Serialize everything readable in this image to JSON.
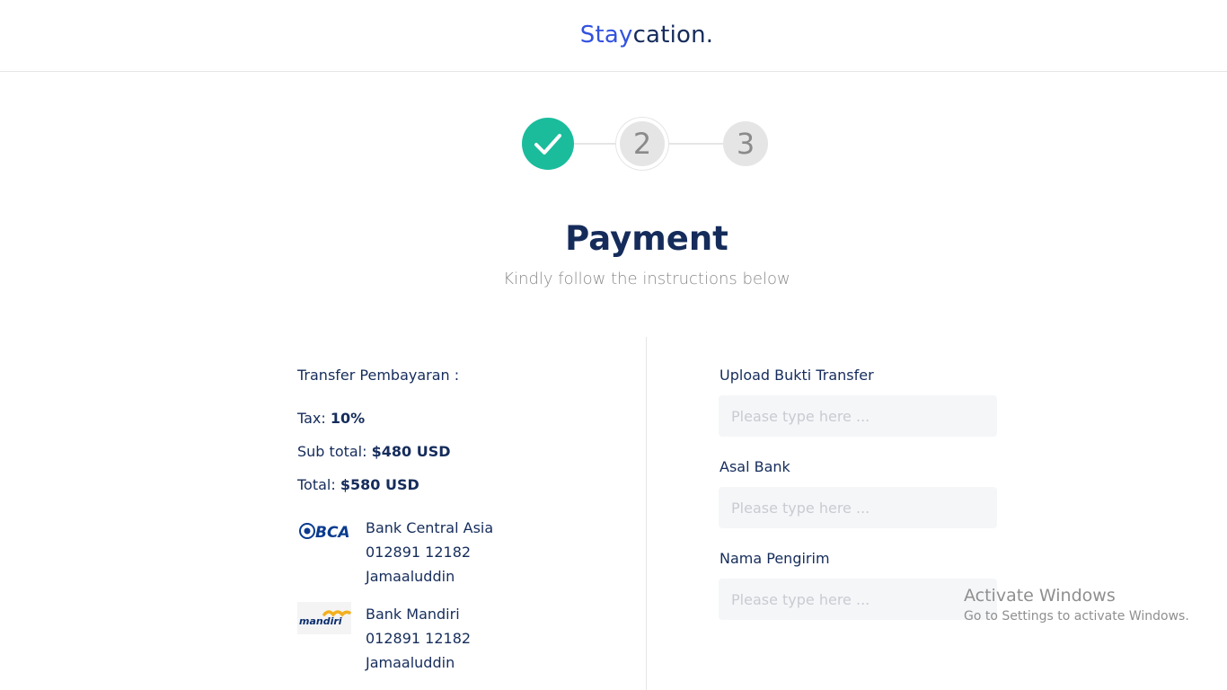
{
  "brand": {
    "accent": "Stay",
    "rest": "cation."
  },
  "stepper": {
    "steps": [
      "✓",
      "2",
      "3"
    ]
  },
  "header": {
    "title": "Payment",
    "subtitle": "Kindly follow  the instructions below"
  },
  "summary": {
    "heading": "Transfer Pembayaran :",
    "tax_label": "Tax:",
    "tax_value": "10%",
    "subtotal_label": "Sub total:",
    "subtotal_value": "$480 USD",
    "total_label": "Total:",
    "total_value": "$580 USD"
  },
  "banks": [
    {
      "logo": "BCA",
      "name": "Bank Central Asia",
      "account": "012891 12182",
      "holder": "Jamaaluddin"
    },
    {
      "logo": "mandiri",
      "name": "Bank Mandiri",
      "account": "012891 12182",
      "holder": "Jamaaluddin"
    }
  ],
  "form": {
    "upload_label": "Upload Bukti Transfer",
    "upload_placeholder": "Please type here ...",
    "bank_label": "Asal Bank",
    "bank_placeholder": "Please type here ...",
    "sender_label": "Nama Pengirim",
    "sender_placeholder": "Please type here ..."
  },
  "watermark": {
    "line1": "Activate Windows",
    "line2": "Go to Settings to activate Windows."
  },
  "colors": {
    "primary": "#3252df",
    "navy": "#152c5b",
    "success": "#1abc9c",
    "muted": "#8a8a8a"
  }
}
